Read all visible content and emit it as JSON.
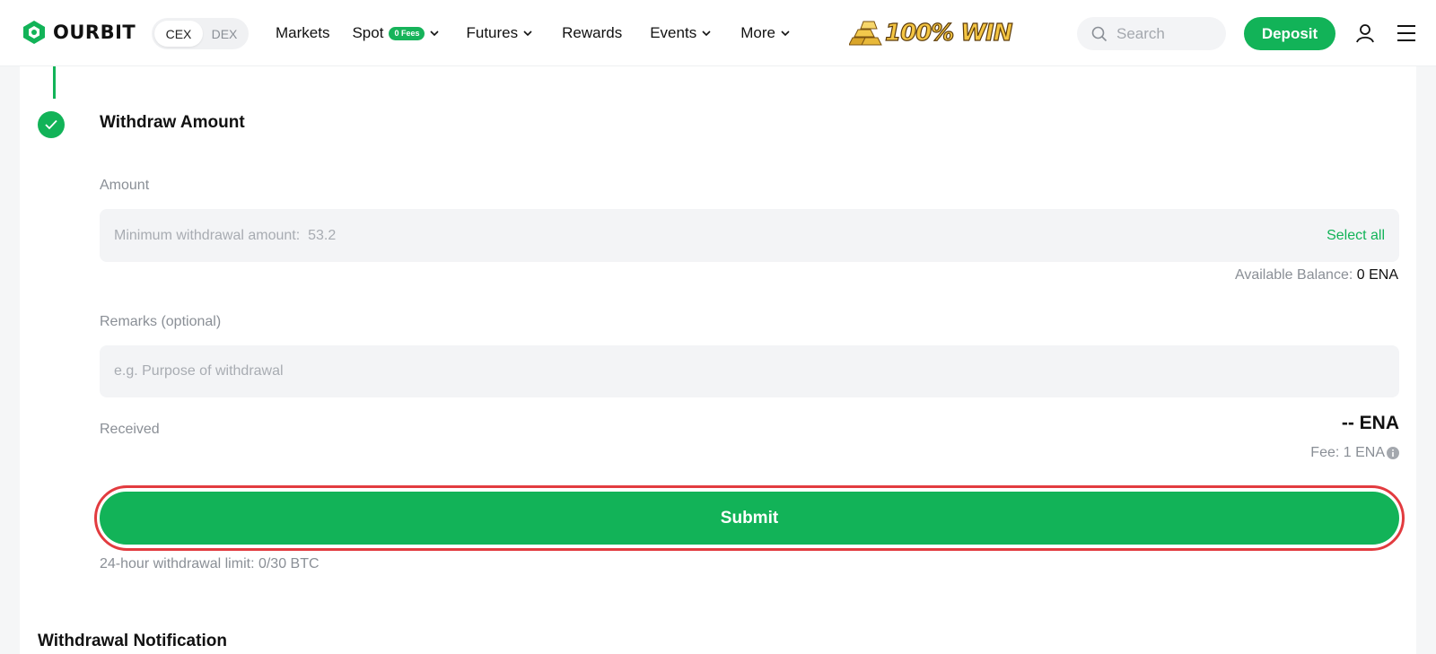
{
  "header": {
    "brand": "OURBIT",
    "mode_toggle": {
      "active": "CEX",
      "inactive": "DEX"
    },
    "nav": {
      "markets": "Markets",
      "spot": "Spot",
      "spot_badge": "0 Fees",
      "futures": "Futures",
      "rewards": "Rewards",
      "events": "Events",
      "more": "More"
    },
    "promo_text": "100% WIN",
    "search_placeholder": "Search",
    "deposit_label": "Deposit"
  },
  "withdraw": {
    "step_title": "Withdraw Amount",
    "amount_label": "Amount",
    "amount_placeholder": "Minimum withdrawal amount:  53.2",
    "select_all": "Select all",
    "available_balance_label": "Available Balance:",
    "available_balance_value": "0 ENA",
    "remarks_label": "Remarks (optional)",
    "remarks_placeholder": "e.g. Purpose of withdrawal",
    "received_label": "Received",
    "received_value": "-- ENA",
    "fee_text": "Fee: 1 ENA",
    "submit_label": "Submit",
    "limit_text": "24-hour withdrawal limit: 0/30 BTC"
  },
  "notification": {
    "title": "Withdrawal Notification"
  },
  "colors": {
    "accent": "#12b358",
    "highlight_ring": "#e23b3f"
  }
}
